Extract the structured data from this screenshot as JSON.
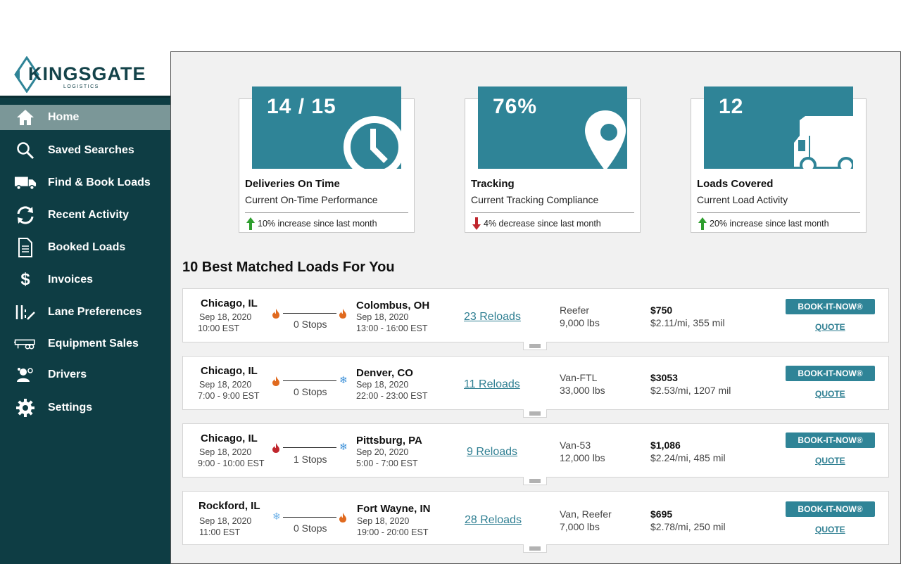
{
  "brand": {
    "name": "KINGSGATE",
    "tagline": "LOGISTICS"
  },
  "colors": {
    "sidebar": "#0e3d44",
    "accent": "#2f8497",
    "active": "#7b9798",
    "up": "#2e9e2e",
    "down": "#c0262d",
    "hot": "#e06a1f",
    "cold": "#3a8fd8"
  },
  "nav": [
    {
      "label": "Home",
      "icon": "home-icon",
      "active": true
    },
    {
      "label": "Saved Searches",
      "icon": "search-icon"
    },
    {
      "label": "Find & Book Loads",
      "icon": "truck-icon"
    },
    {
      "label": "Recent Activity",
      "icon": "refresh-icon"
    },
    {
      "label": "Booked Loads",
      "icon": "document-icon"
    },
    {
      "label": "Invoices",
      "icon": "dollar-icon"
    },
    {
      "label": "Lane Preferences",
      "icon": "lanes-icon"
    },
    {
      "label": "Equipment Sales",
      "icon": "trailer-icon"
    },
    {
      "label": "Drivers",
      "icon": "drivers-icon"
    },
    {
      "label": "Settings",
      "icon": "gear-icon"
    }
  ],
  "kpis": [
    {
      "value": "14 / 15",
      "title": "Deliveries On Time",
      "desc": "Current On-Time Performance",
      "trend": "up",
      "trend_text": "10% increase since last month",
      "icon": "clock-icon"
    },
    {
      "value": "76%",
      "title": "Tracking",
      "desc": "Current Tracking Compliance",
      "trend": "down",
      "trend_text": "4% decrease since last month",
      "icon": "location-pin-icon"
    },
    {
      "value": "12",
      "title": "Loads Covered",
      "desc": "Current Load Activity",
      "trend": "up",
      "trend_text": "20% increase since last month",
      "icon": "truck-icon"
    }
  ],
  "loads_title": "10 Best Matched Loads For You",
  "loads": [
    {
      "origin": "Chicago, IL",
      "origin_date": "Sep 18, 2020",
      "origin_time": "10:00 EST",
      "origin_temp": "hot",
      "stops": "0 Stops",
      "dest": "Colombus, OH",
      "dest_date": "Sep 18, 2020",
      "dest_time": "13:00 - 16:00 EST",
      "dest_temp": "hot",
      "reloads": "23 Reloads",
      "equipment": "Reefer",
      "weight": "9,000 lbs",
      "price": "$750",
      "rate": "$2.11/mi, 355 mil"
    },
    {
      "origin": "Chicago, IL",
      "origin_date": "Sep 18, 2020",
      "origin_time": "7:00 - 9:00 EST",
      "origin_temp": "hot",
      "stops": "0 Stops",
      "dest": "Denver, CO",
      "dest_date": "Sep 18, 2020",
      "dest_time": "22:00 - 23:00 EST",
      "dest_temp": "cold",
      "reloads": "11 Reloads",
      "equipment": "Van-FTL",
      "weight": "33,000 lbs",
      "price": "$3053",
      "rate": "$2.53/mi, 1207 mil"
    },
    {
      "origin": "Chicago, IL",
      "origin_date": "Sep 18, 2020",
      "origin_time": "9:00 - 10:00 EST",
      "origin_temp": "hot-red",
      "stops": "1 Stops",
      "dest": "Pittsburg, PA",
      "dest_date": "Sep 20, 2020",
      "dest_time": "5:00 - 7:00 EST",
      "dest_temp": "cold",
      "reloads": "9 Reloads",
      "equipment": "Van-53",
      "weight": "12,000 lbs",
      "price": "$1,086",
      "rate": "$2.24/mi, 485 mil"
    },
    {
      "origin": "Rockford, IL",
      "origin_date": "Sep 18, 2020",
      "origin_time": "11:00 EST",
      "origin_temp": "cold",
      "stops": "0 Stops",
      "dest": "Fort Wayne, IN",
      "dest_date": "Sep 18, 2020",
      "dest_time": "19:00 - 20:00 EST",
      "dest_temp": "hot",
      "reloads": "28 Reloads",
      "equipment": "Van, Reefer",
      "weight": "7,000 lbs",
      "price": "$695",
      "rate": "$2.78/mi, 250 mil"
    }
  ],
  "actions": {
    "book": "BOOK-IT-NOW®",
    "quote": "QUOTE"
  }
}
